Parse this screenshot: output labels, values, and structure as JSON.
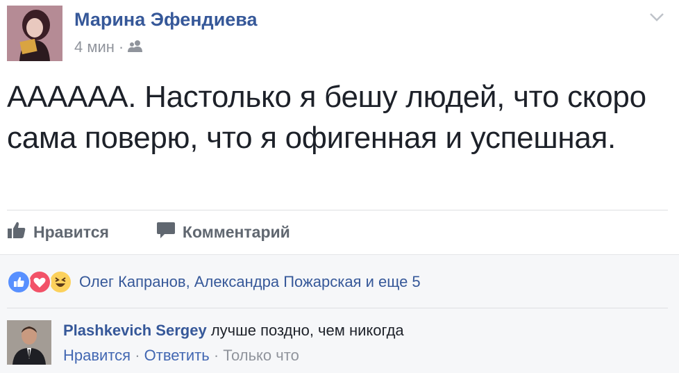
{
  "post": {
    "author_name": "Марина Эфендиева",
    "time": "4 мин",
    "separator": "·",
    "privacy_icon": "friends-icon",
    "text": "АААААА. Настолько я бешу людей, что скоро сама поверю, что я офигенная и успешная.",
    "actions": {
      "like_label": "Нравится",
      "comment_label": "Комментарий"
    }
  },
  "reactions": {
    "icons": [
      "like-reaction-icon",
      "love-reaction-icon",
      "haha-reaction-icon"
    ],
    "text": "Олег Капранов, Александра Пожарская и еще 5"
  },
  "comment": {
    "author": "Plashkevich Sergey",
    "text": "лучше поздно, чем никогда",
    "like_label": "Нравится",
    "reply_label": "Ответить",
    "separator": "·",
    "time": "Только что"
  },
  "colors": {
    "link": "#365899",
    "meta": "#90949c",
    "action": "#606770",
    "like_blue": "#5890ff",
    "love_red": "#f25268",
    "haha_yellow": "#fcd15c"
  }
}
